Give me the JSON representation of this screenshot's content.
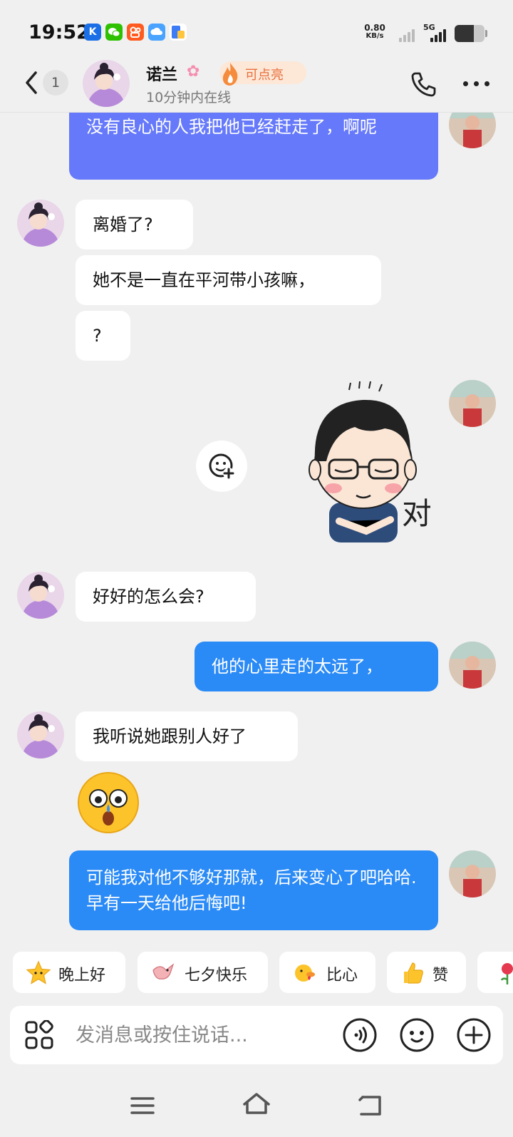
{
  "status_bar": {
    "time": "19:52",
    "net_speed_value": "0.80",
    "net_speed_unit": "KB/s",
    "network_type": "5G",
    "battery_level": 0.65,
    "app_icons": [
      {
        "name": "k-app-icon",
        "glyph": "K",
        "color": "#1a6fe6"
      },
      {
        "name": "wechat-icon",
        "glyph": "●",
        "color": "#2dc100"
      },
      {
        "name": "kuaishou-icon",
        "glyph": "●",
        "color": "#ff5a1f"
      },
      {
        "name": "cloud-icon",
        "glyph": "☁",
        "color": "#4aa3ff"
      },
      {
        "name": "document-icon",
        "glyph": "■",
        "color": "#3d7bf7"
      }
    ]
  },
  "header": {
    "unread_count": "1",
    "contact_name": "诺兰",
    "name_emoji_icon": "cherry-blossom-icon",
    "flame_label": "可点亮",
    "status": "10分钟内在线"
  },
  "messages": [
    {
      "side": "out",
      "text": "没有良心的人我把他已经赶走了，啊呢",
      "color": "#6579fa"
    },
    {
      "side": "in",
      "text": "离婚了?"
    },
    {
      "side": "in",
      "text": "她不是一直在平河带小孩嘛，"
    },
    {
      "side": "in",
      "text": "?"
    },
    {
      "side": "out",
      "type": "sticker",
      "sticker_text": "对"
    },
    {
      "side": "in",
      "text": "好好的怎么会?"
    },
    {
      "side": "out",
      "text": "他的心里走的太远了，",
      "color": "#2a8af6"
    },
    {
      "side": "in",
      "text": "我听说她跟别人好了"
    },
    {
      "side": "in",
      "type": "emoji",
      "emoji": "shocked-face-icon"
    },
    {
      "side": "out",
      "text": "可能我对他不够好那就，后来变心了吧哈哈.早有一天给他后悔吧!",
      "color": "#2a8af6"
    }
  ],
  "quick_replies": [
    {
      "icon": "star-face-icon",
      "label": "晚上好"
    },
    {
      "icon": "magpie-icon",
      "label": "七夕快乐"
    },
    {
      "icon": "duck-heart-icon",
      "label": "比心"
    },
    {
      "icon": "thumbs-up-icon",
      "label": "赞"
    },
    {
      "icon": "rose-icon",
      "label": ""
    }
  ],
  "input": {
    "placeholder": "发消息或按住说话..."
  },
  "nav": {
    "buttons": [
      "menu",
      "home",
      "back"
    ]
  }
}
